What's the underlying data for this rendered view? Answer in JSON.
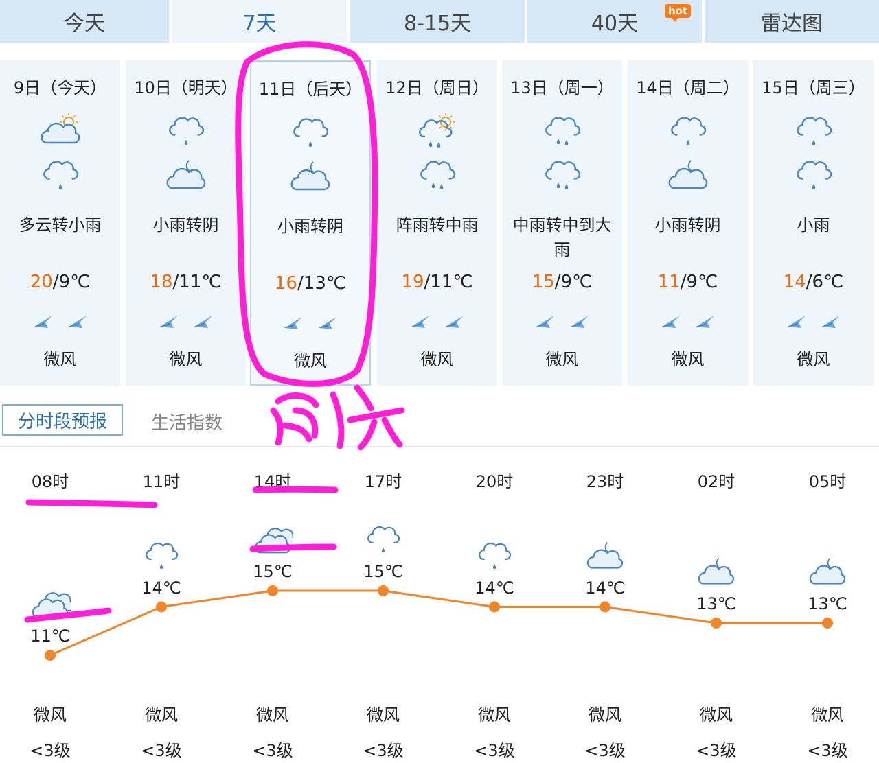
{
  "tabs": [
    {
      "label": "今天"
    },
    {
      "label": "7天",
      "active": true
    },
    {
      "label": "8-15天"
    },
    {
      "label": "40天",
      "badge": "hot"
    },
    {
      "label": "雷达图"
    }
  ],
  "days": [
    {
      "date": "9日（今天）",
      "icon1": "partly-cloudy-icon",
      "icon2": "rain-icon",
      "desc": "多云转小雨",
      "high": "20",
      "low": "9℃",
      "wind": "微风"
    },
    {
      "date": "10日（明天）",
      "icon1": "rain-icon",
      "icon2": "overcast-night-icon",
      "desc": "小雨转阴",
      "high": "18",
      "low": "11℃",
      "wind": "微风"
    },
    {
      "date": "11日（后天）",
      "icon1": "rain-icon",
      "icon2": "overcast-night-icon",
      "desc": "小雨转阴",
      "high": "16",
      "low": "13℃",
      "wind": "微风",
      "selected": true
    },
    {
      "date": "12日（周日）",
      "icon1": "shower-icon",
      "icon2": "moderate-rain-icon",
      "desc": "阵雨转中雨",
      "high": "19",
      "low": "11℃",
      "wind": "微风"
    },
    {
      "date": "13日（周一）",
      "icon1": "moderate-rain-icon",
      "icon2": "moderate-rain-icon",
      "desc": "中雨转中到大雨",
      "high": "15",
      "low": "9℃",
      "wind": "微风"
    },
    {
      "date": "14日（周二）",
      "icon1": "rain-icon",
      "icon2": "overcast-night-icon",
      "desc": "小雨转阴",
      "high": "11",
      "low": "9℃",
      "wind": "微风"
    },
    {
      "date": "15日（周三）",
      "icon1": "rain-icon",
      "icon2": "rain-icon",
      "desc": "小雨",
      "high": "14",
      "low": "6℃",
      "wind": "微风"
    }
  ],
  "temp_sep": "/",
  "section_tabs": {
    "hourly": "分时段预报",
    "life": "生活指数"
  },
  "hourly": [
    {
      "time": "08时",
      "icon": "cloudy-icon",
      "temp": "11℃",
      "wind": "微风",
      "level": "<3级"
    },
    {
      "time": "11时",
      "icon": "rain-icon",
      "temp": "14℃",
      "wind": "微风",
      "level": "<3级"
    },
    {
      "time": "14时",
      "icon": "cloudy-icon",
      "temp": "15℃",
      "wind": "微风",
      "level": "<3级"
    },
    {
      "time": "17时",
      "icon": "rain-icon",
      "temp": "15℃",
      "wind": "微风",
      "level": "<3级"
    },
    {
      "time": "20时",
      "icon": "rain-icon",
      "temp": "14℃",
      "wind": "微风",
      "level": "<3级"
    },
    {
      "time": "23时",
      "icon": "overcast-night-icon",
      "temp": "14℃",
      "wind": "微风",
      "level": "<3级"
    },
    {
      "time": "02时",
      "icon": "overcast-night-icon",
      "temp": "13℃",
      "wind": "微风",
      "level": "<3级"
    },
    {
      "time": "05时",
      "icon": "overcast-night-icon",
      "temp": "13℃",
      "wind": "微风",
      "level": "<3级"
    }
  ],
  "chart_data": {
    "type": "line",
    "x": [
      "08时",
      "11时",
      "14时",
      "17时",
      "20时",
      "23时",
      "02时",
      "05时"
    ],
    "series": [
      {
        "values": [
          11,
          14,
          15,
          15,
          14,
          14,
          13,
          13
        ]
      }
    ],
    "color": "#f0862a"
  },
  "colors": {
    "accent": "#2a6fb8",
    "high_temp": "#ee6a0f",
    "annotation": "#ff1fd7",
    "icon_stroke": "#4a86c0"
  }
}
